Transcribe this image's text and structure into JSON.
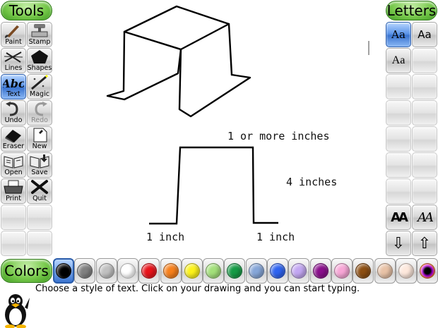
{
  "tools_panel": {
    "title": "Tools",
    "buttons": [
      {
        "label": "Paint",
        "icon": "paintbrush-icon"
      },
      {
        "label": "Stamp",
        "icon": "stamp-icon"
      },
      {
        "label": "Lines",
        "icon": "lines-icon"
      },
      {
        "label": "Shapes",
        "icon": "pentagon-icon"
      },
      {
        "label": "Text",
        "icon": "text-abc-icon",
        "glyph": "Abc",
        "selected": true
      },
      {
        "label": "Magic",
        "icon": "magic-wand-icon"
      },
      {
        "label": "Undo",
        "icon": "undo-icon"
      },
      {
        "label": "Redo",
        "icon": "redo-icon",
        "disabled": true
      },
      {
        "label": "Eraser",
        "icon": "eraser-icon"
      },
      {
        "label": "New",
        "icon": "new-page-icon"
      },
      {
        "label": "Open",
        "icon": "open-book-icon"
      },
      {
        "label": "Save",
        "icon": "save-book-icon"
      },
      {
        "label": "Print",
        "icon": "printer-icon"
      },
      {
        "label": "Quit",
        "icon": "quit-x-icon"
      }
    ]
  },
  "letters_panel": {
    "title": "Letters",
    "fonts": [
      {
        "sample": "Aa",
        "font": "serif",
        "selected": true
      },
      {
        "sample": "Aa",
        "font": "sans"
      },
      {
        "sample": "Aa",
        "font": "serif-bold"
      }
    ],
    "size_buttons": [
      {
        "sample": "AA",
        "name": "text-bold-size-icon"
      },
      {
        "sample": "AA",
        "name": "text-italic-size-icon"
      }
    ],
    "arrows": [
      {
        "name": "scroll-down-arrow-icon",
        "glyph": "⇩"
      },
      {
        "name": "scroll-up-arrow-icon",
        "glyph": "⇧"
      }
    ]
  },
  "colors_panel": {
    "title": "Colors",
    "swatches": [
      "#000000",
      "#808080",
      "#c0c0c0",
      "#ffffff",
      "#e8131a",
      "#f7801c",
      "#fcf21a",
      "#a3e07a",
      "#159a45",
      "#86a6d8",
      "#2e63f0",
      "#c3a7f2",
      "#8a0f8c",
      "#f7a6d6",
      "#8c4e12",
      "#e8c2a6",
      "#fde8dc",
      "#000000"
    ],
    "selected_index": 0
  },
  "canvas": {
    "labels": {
      "top": "1 or more inches",
      "right": "4 inches",
      "left_bottom": "1 inch",
      "right_bottom": "1 inch"
    }
  },
  "status_message": "Choose a style of text. Click on your drawing and you can start typing.",
  "mascot": "tux-penguin-icon"
}
